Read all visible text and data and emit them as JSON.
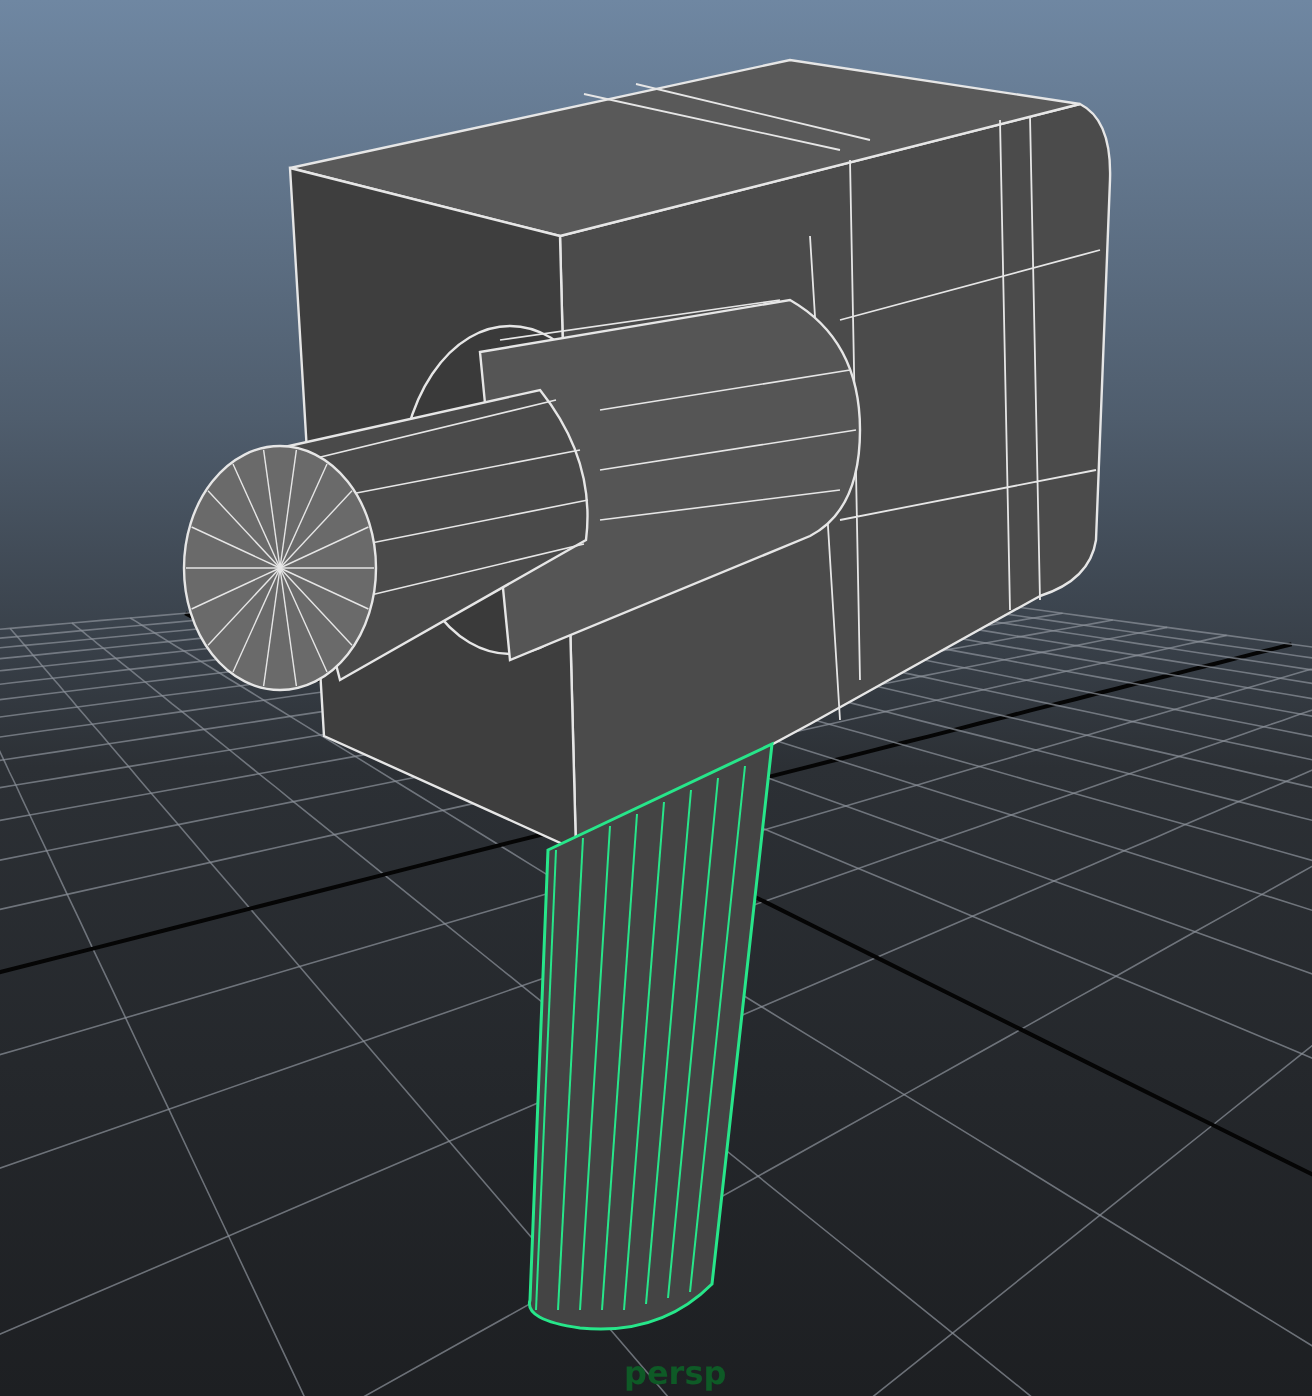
{
  "viewport": {
    "camera_label": "persp"
  },
  "parts": [
    {
      "kind": "body",
      "selected": false
    },
    {
      "kind": "lens",
      "selected": false
    },
    {
      "kind": "handle",
      "selected": true
    }
  ]
}
